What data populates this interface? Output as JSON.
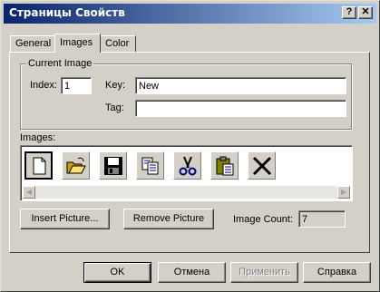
{
  "window": {
    "title": "Страницы Свойств",
    "help_symbol": "?",
    "close_symbol": "✕"
  },
  "tabs": [
    {
      "label": "General"
    },
    {
      "label": "Images"
    },
    {
      "label": "Color"
    }
  ],
  "current_image": {
    "group_label": "Current Image",
    "index_label": "Index:",
    "index_value": "1",
    "key_label": "Key:",
    "key_value": "New",
    "tag_label": "Tag:",
    "tag_value": ""
  },
  "images": {
    "label": "Images:",
    "icons": [
      "new-document-icon",
      "open-folder-icon",
      "save-disk-icon",
      "copy-icon",
      "cut-scissors-icon",
      "paste-icon",
      "delete-x-icon"
    ]
  },
  "actions": {
    "insert_picture": "Insert Picture...",
    "remove_picture": "Remove Picture",
    "image_count_label": "Image Count:",
    "image_count_value": "7"
  },
  "footer": {
    "ok": "OK",
    "cancel": "Отмена",
    "apply": "Применить",
    "help": "Справка"
  }
}
